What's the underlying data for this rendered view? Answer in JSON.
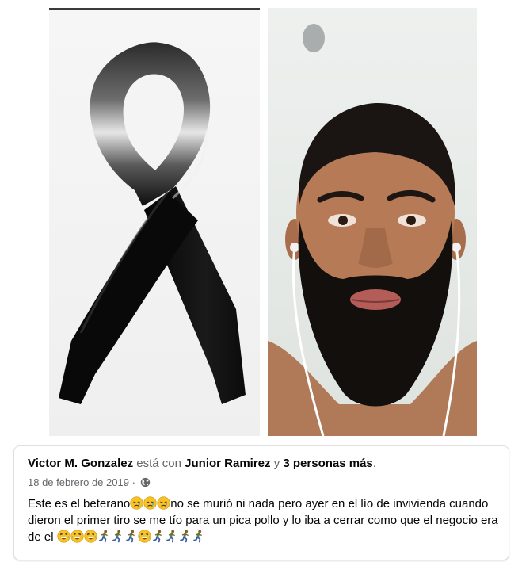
{
  "post": {
    "author": "Victor M. Gonzalez",
    "with_text": "está con",
    "tagged": "Junior Ramirez",
    "and_text": "y",
    "others": "3 personas más",
    "period": ".",
    "date": "18 de febrero de 2019",
    "separator": "·",
    "audience_icon": "globe-icon",
    "body_part1": "Este es el beterano",
    "body_part2": "no se murió ni nada pero ayer en el lío de invivienda cuando dieron el  primer tiro se me tío para un pica pollo y lo iba a cerrar como que el negocio era  de el",
    "emoji_set_1": [
      "sad-face",
      "sad-face",
      "sad-face"
    ],
    "emoji_set_2": [
      "laughing-face",
      "laughing-face",
      "laughing-face",
      "running-person",
      "running-person",
      "running-person",
      "laughing-face",
      "running-person",
      "running-person",
      "running-person",
      "running-person"
    ]
  },
  "photos": [
    {
      "name": "black-ribbon-image"
    },
    {
      "name": "man-selfie-image"
    }
  ],
  "colors": {
    "text_primary": "#050505",
    "text_secondary": "#65676b",
    "border": "#dcdfe3"
  }
}
